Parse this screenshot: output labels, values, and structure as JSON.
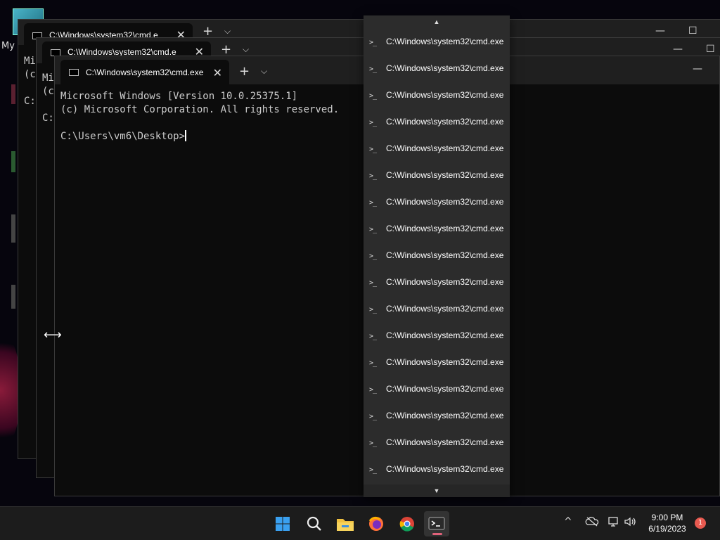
{
  "desktop": {
    "icon_label": "My"
  },
  "windows": [
    {
      "tab_title": "C:\\Windows\\system32\\cmd.e",
      "new_tab": "+",
      "menu": "⌵",
      "close": "✕",
      "lines": [
        "Mi",
        "(c",
        "",
        "C:"
      ]
    },
    {
      "tab_title": "C:\\Windows\\system32\\cmd.e",
      "new_tab": "+",
      "menu": "⌵",
      "close": "✕",
      "lines": [
        "Mi",
        "(c",
        "",
        "C:"
      ]
    },
    {
      "tab_title": "C:\\Windows\\system32\\cmd.exe",
      "new_tab": "+",
      "menu": "⌵",
      "close": "✕",
      "lines": [
        "Microsoft Windows [Version 10.0.25375.1]",
        "(c) Microsoft Corporation. All rights reserved.",
        "",
        "C:\\Users\\vm6\\Desktop>"
      ]
    }
  ],
  "window_controls": {
    "minimize": "—",
    "maximize": "☐"
  },
  "dropdown": {
    "scroll_up": "▲",
    "scroll_down": "▼",
    "items": [
      "C:\\Windows\\system32\\cmd.exe",
      "C:\\Windows\\system32\\cmd.exe",
      "C:\\Windows\\system32\\cmd.exe",
      "C:\\Windows\\system32\\cmd.exe",
      "C:\\Windows\\system32\\cmd.exe",
      "C:\\Windows\\system32\\cmd.exe",
      "C:\\Windows\\system32\\cmd.exe",
      "C:\\Windows\\system32\\cmd.exe",
      "C:\\Windows\\system32\\cmd.exe",
      "C:\\Windows\\system32\\cmd.exe",
      "C:\\Windows\\system32\\cmd.exe",
      "C:\\Windows\\system32\\cmd.exe",
      "C:\\Windows\\system32\\cmd.exe",
      "C:\\Windows\\system32\\cmd.exe",
      "C:\\Windows\\system32\\cmd.exe",
      "C:\\Windows\\system32\\cmd.exe",
      "C:\\Windows\\system32\\cmd.exe"
    ]
  },
  "icons": {
    "terminal": "terminal-icon",
    "cursor": "resize-horizontal-cursor"
  },
  "taskbar": {
    "apps": [
      "windows-start-icon",
      "search-icon",
      "file-explorer-icon",
      "firefox-icon",
      "chrome-icon",
      "terminal-icon"
    ],
    "tray_chevron": "^",
    "clock_time": "9:00 PM",
    "clock_date": "6/19/2023",
    "notification_count": "1",
    "accent": "#e0627a"
  },
  "colors": {
    "terminal_bg": "#0c0c0c",
    "titlebar": "#1f1f1f",
    "dropdown_bg": "#2c2c2c",
    "taskbar": "#1c1c1c"
  }
}
